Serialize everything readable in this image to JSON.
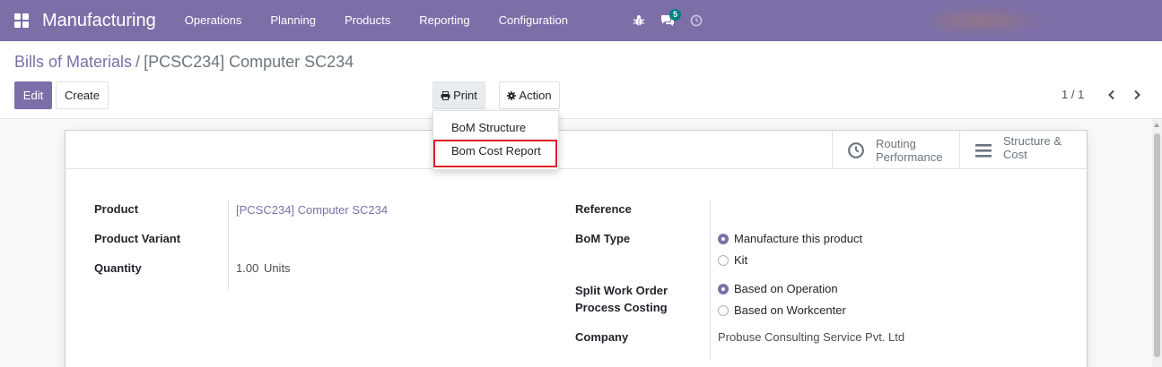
{
  "navbar": {
    "app_title": "Manufacturing",
    "menu": [
      "Operations",
      "Planning",
      "Products",
      "Reporting",
      "Configuration"
    ],
    "messages_badge": "5",
    "icons": [
      "bug-icon",
      "chat-icon",
      "clock-icon"
    ]
  },
  "breadcrumb": {
    "parent": "Bills of Materials",
    "separator": "/",
    "current": "[PCSC234] Computer SC234"
  },
  "toolbar": {
    "edit_label": "Edit",
    "create_label": "Create",
    "print_label": "Print",
    "action_label": "Action"
  },
  "pager": {
    "value": "1 / 1"
  },
  "print_dropdown": {
    "items": [
      "BoM Structure",
      "Bom Cost Report"
    ],
    "highlighted": "Bom Cost Report"
  },
  "smart_buttons": {
    "routing": {
      "line1": "Routing",
      "line2": "Performance"
    },
    "structure": {
      "line1": "Structure &",
      "line2": "Cost"
    }
  },
  "form": {
    "left": {
      "product_label": "Product",
      "product_value": "[PCSC234] Computer SC234",
      "variant_label": "Product Variant",
      "variant_value": "",
      "quantity_label": "Quantity",
      "quantity_value": "1.00",
      "quantity_uom": "Units"
    },
    "right": {
      "reference_label": "Reference",
      "reference_value": "",
      "bom_type_label": "BoM Type",
      "bom_type_options": [
        "Manufacture this product",
        "Kit"
      ],
      "bom_type_selected": "Manufacture this product",
      "split_label_1": "Split Work Order",
      "split_label_2": "Process Costing",
      "split_options": [
        "Based on Operation",
        "Based on Workcenter"
      ],
      "split_selected": "Based on Operation",
      "company_label": "Company",
      "company_value": "Probuse Consulting Service Pvt. Ltd"
    }
  },
  "colors": {
    "brand": "#7c6fa8",
    "badge": "#017e84",
    "highlight_box": "#e01b24"
  }
}
